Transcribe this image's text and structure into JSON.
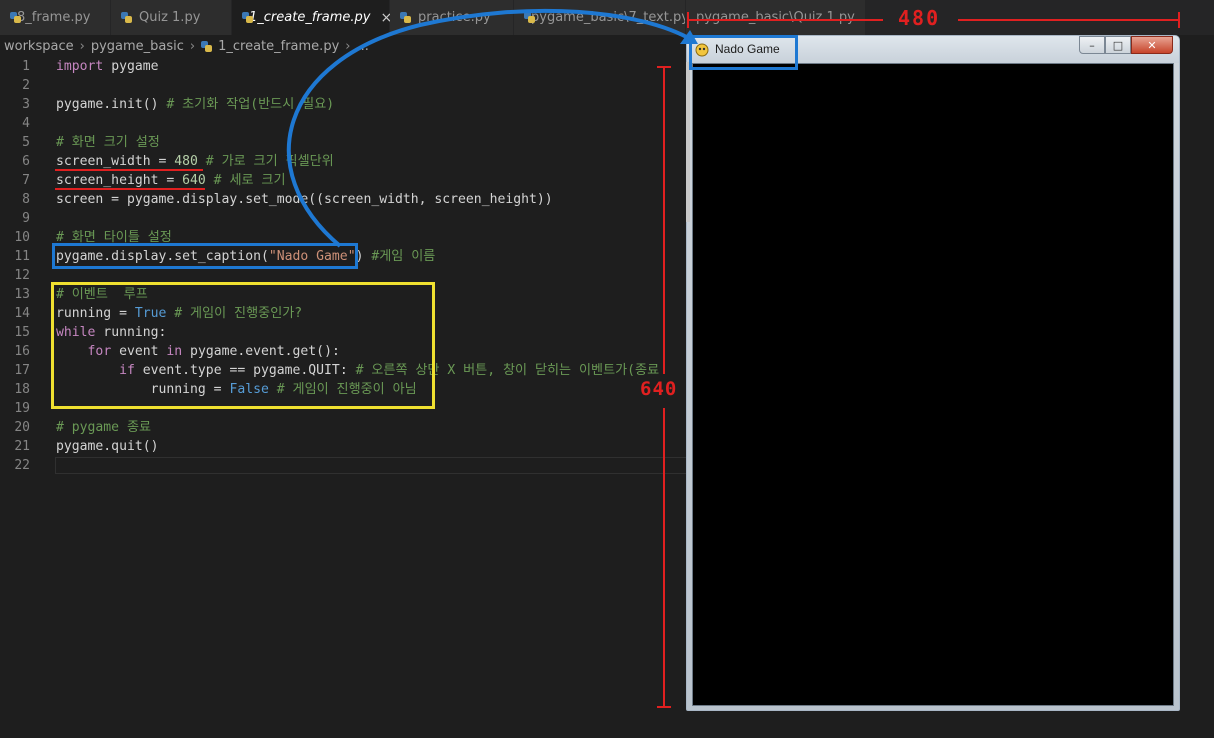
{
  "tabs": [
    {
      "label": "8_frame.py",
      "active": false,
      "modified": true
    },
    {
      "label": "Quiz 1.py",
      "active": false,
      "modified": false
    },
    {
      "label": "1_create_frame.py",
      "active": true,
      "modified": false
    },
    {
      "label": "practice.py",
      "active": false,
      "modified": false
    },
    {
      "label": "pygame_basic\\7_text.py",
      "active": false,
      "modified": false
    },
    {
      "label": "pygame_basic\\Quiz 1.py",
      "active": false,
      "modified": false
    }
  ],
  "tab_close_glyph": "×",
  "breadcrumb": {
    "root": "workspace",
    "folder": "pygame_basic",
    "file": "1_create_frame.py",
    "more": "..."
  },
  "line_numbers": [
    "1",
    "2",
    "3",
    "4",
    "5",
    "6",
    "7",
    "8",
    "9",
    "10",
    "11",
    "12",
    "13",
    "14",
    "15",
    "16",
    "17",
    "18",
    "19",
    "20",
    "21",
    "22"
  ],
  "code": {
    "l1": {
      "kw": "import",
      "rest": " pygame"
    },
    "l3": {
      "code": "pygame.init() ",
      "comment": "# 초기화 작업(반드시 필요)"
    },
    "l5": {
      "comment": "# 화면 크기 설정"
    },
    "l6": {
      "var": "screen_width",
      "eq": " = ",
      "num": "480",
      "comment": " # 가로 크기 픽셀단위"
    },
    "l7": {
      "var": "screen_height",
      "eq": " = ",
      "num": "640",
      "comment": " # 세로 크기"
    },
    "l8": {
      "code": "screen = pygame.display.set_mode((screen_width, screen_height))"
    },
    "l10": {
      "comment": "# 화면 타이틀 설정"
    },
    "l11": {
      "code1": "pygame.display.set_caption(",
      "str": "\"Nado Game\"",
      "code2": ") ",
      "comment": "#게임 이름"
    },
    "l13": {
      "comment": "# 이벤트  루프"
    },
    "l14": {
      "code": "running = ",
      "const": "True",
      "comment": " # 게임이 진행중인가?"
    },
    "l15": {
      "kw": "while",
      "rest": " running:"
    },
    "l16": {
      "indent": "    ",
      "kw1": "for",
      "mid": " event ",
      "kw2": "in",
      "rest": " pygame.event.get():"
    },
    "l17": {
      "indent": "        ",
      "kw": "if",
      "rest": " event.type == pygame.QUIT: ",
      "comment": "# 오른쪽 상단 X 버튼, 창이 닫히는 이벤트가(종료"
    },
    "l18": {
      "indent": "            ",
      "code": "running = ",
      "const": "False",
      "comment": " # 게임이 진행중이 아님"
    },
    "l20": {
      "comment": "# pygame 종료"
    },
    "l21": {
      "code": "pygame.quit()"
    }
  },
  "game_window": {
    "title": "Nado Game",
    "controls": {
      "minimize": "–",
      "maximize": "□",
      "close": "✕"
    },
    "canvas_color": "#000000"
  },
  "annotations": {
    "width_label": "480",
    "height_label": "640",
    "underline_color": "#e02020",
    "caption_box_color": "#1e78d2",
    "loop_box_color": "#f0e030"
  }
}
